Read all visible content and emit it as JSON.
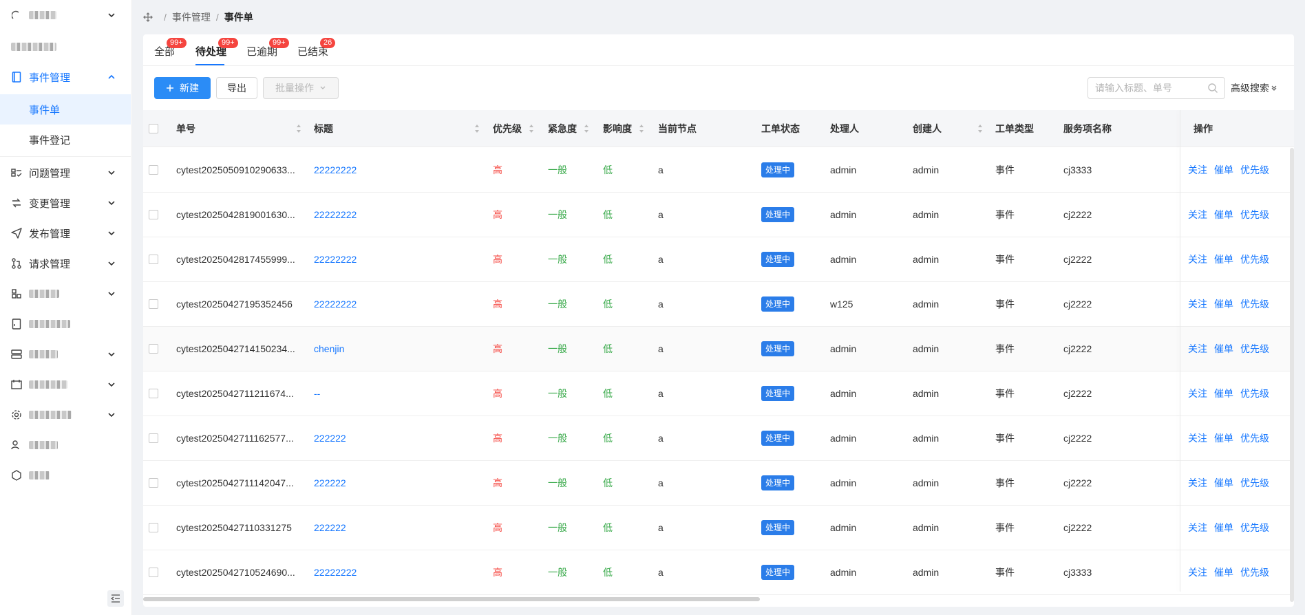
{
  "sidebar": {
    "items": [
      {
        "label": "",
        "has_chevron": true
      },
      {
        "label": "",
        "has_chevron": false
      },
      {
        "label": "事件管理",
        "has_chevron": true,
        "expanded": true
      },
      {
        "label": "问题管理",
        "has_chevron": true
      },
      {
        "label": "变更管理",
        "has_chevron": true
      },
      {
        "label": "发布管理",
        "has_chevron": true
      },
      {
        "label": "请求管理",
        "has_chevron": true
      },
      {
        "label": "",
        "has_chevron": true
      },
      {
        "label": "",
        "has_chevron": false
      },
      {
        "label": "",
        "has_chevron": true
      },
      {
        "label": "",
        "has_chevron": true
      },
      {
        "label": "",
        "has_chevron": true
      },
      {
        "label": "",
        "has_chevron": false
      },
      {
        "label": "",
        "has_chevron": false
      }
    ],
    "sub_items": [
      {
        "label": "事件单",
        "active": true
      },
      {
        "label": "事件登记",
        "active": false
      }
    ]
  },
  "breadcrumb": {
    "items": [
      "事件管理",
      "事件单"
    ],
    "separator": "/"
  },
  "tabs": [
    {
      "label": "全部",
      "badge": "99+",
      "active": false
    },
    {
      "label": "待处理",
      "badge": "99+",
      "active": true
    },
    {
      "label": "已逾期",
      "badge": "99+",
      "active": false
    },
    {
      "label": "已结束",
      "badge": "26",
      "active": false
    }
  ],
  "toolbar": {
    "new_label": "新建",
    "export_label": "导出",
    "batch_label": "批量操作",
    "search_placeholder": "请输入标题、单号",
    "advanced_search_label": "高级搜索"
  },
  "table": {
    "columns": [
      "单号",
      "标题",
      "优先级",
      "紧急度",
      "影响度",
      "当前节点",
      "工单状态",
      "处理人",
      "创建人",
      "工单类型",
      "服务项名称",
      "操作"
    ],
    "rows": [
      {
        "id": "cytest2025050910290633...",
        "title": "22222222",
        "priority": "高",
        "urgency": "一般",
        "impact": "低",
        "node": "a",
        "status": "处理中",
        "handler": "admin",
        "creator": "admin",
        "type": "事件",
        "service": "cj3333"
      },
      {
        "id": "cytest2025042819001630...",
        "title": "22222222",
        "priority": "高",
        "urgency": "一般",
        "impact": "低",
        "node": "a",
        "status": "处理中",
        "handler": "admin",
        "creator": "admin",
        "type": "事件",
        "service": "cj2222"
      },
      {
        "id": "cytest2025042817455999...",
        "title": "22222222",
        "priority": "高",
        "urgency": "一般",
        "impact": "低",
        "node": "a",
        "status": "处理中",
        "handler": "admin",
        "creator": "admin",
        "type": "事件",
        "service": "cj2222"
      },
      {
        "id": "cytest20250427195352456",
        "title": "22222222",
        "priority": "高",
        "urgency": "一般",
        "impact": "低",
        "node": "a",
        "status": "处理中",
        "handler": "w125",
        "creator": "admin",
        "type": "事件",
        "service": "cj2222"
      },
      {
        "id": "cytest2025042714150234...",
        "title": "chenjin",
        "priority": "高",
        "urgency": "一般",
        "impact": "低",
        "node": "a",
        "status": "处理中",
        "handler": "admin",
        "creator": "admin",
        "type": "事件",
        "service": "cj2222"
      },
      {
        "id": "cytest2025042711211674...",
        "title": "--",
        "priority": "高",
        "urgency": "一般",
        "impact": "低",
        "node": "a",
        "status": "处理中",
        "handler": "admin",
        "creator": "admin",
        "type": "事件",
        "service": "cj2222"
      },
      {
        "id": "cytest2025042711162577...",
        "title": "222222",
        "priority": "高",
        "urgency": "一般",
        "impact": "低",
        "node": "a",
        "status": "处理中",
        "handler": "admin",
        "creator": "admin",
        "type": "事件",
        "service": "cj2222"
      },
      {
        "id": "cytest2025042711142047...",
        "title": "222222",
        "priority": "高",
        "urgency": "一般",
        "impact": "低",
        "node": "a",
        "status": "处理中",
        "handler": "admin",
        "creator": "admin",
        "type": "事件",
        "service": "cj2222"
      },
      {
        "id": "cytest20250427110331275",
        "title": "222222",
        "priority": "高",
        "urgency": "一般",
        "impact": "低",
        "node": "a",
        "status": "处理中",
        "handler": "admin",
        "creator": "admin",
        "type": "事件",
        "service": "cj2222"
      },
      {
        "id": "cytest2025042710524690...",
        "title": "22222222",
        "priority": "高",
        "urgency": "一般",
        "impact": "低",
        "node": "a",
        "status": "处理中",
        "handler": "admin",
        "creator": "admin",
        "type": "事件",
        "service": "cj3333"
      }
    ],
    "row_actions": [
      "关注",
      "催单",
      "优先级"
    ]
  },
  "colors": {
    "accent": "#1677ff",
    "primary_button": "#2b8cf6",
    "badge": "#f5453f",
    "priority_high": "#f5453f",
    "green_value": "#3aaa4b",
    "status_tag": "#2b7de9"
  }
}
